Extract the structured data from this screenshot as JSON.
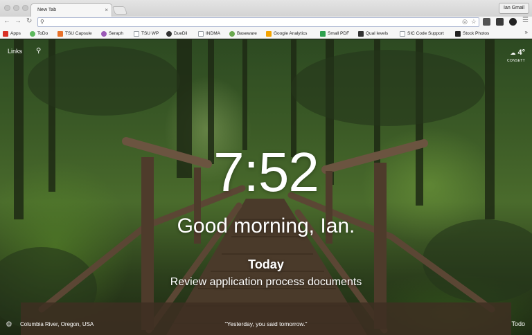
{
  "browser": {
    "tab_title": "New Tab",
    "tab_close": "×",
    "profile_name": "Ian Gmail",
    "omnibox_value": ""
  },
  "bookmarks": [
    {
      "label": "Apps",
      "color": "#d93025"
    },
    {
      "label": "ToDo",
      "color": "#5cb85c"
    },
    {
      "label": "TSU Capsule",
      "color": "#e8712a"
    },
    {
      "label": "Seraph",
      "color": "#9b59b6"
    },
    {
      "label": "TSU WP",
      "color": "#9aa0a6"
    },
    {
      "label": "DueDil",
      "color": "#333333"
    },
    {
      "label": "INDMA",
      "color": "#9aa0a6"
    },
    {
      "label": "Baseware",
      "color": "#6aa84f"
    },
    {
      "label": "Google Analytics",
      "color": "#f4a300"
    },
    {
      "label": "Small PDF",
      "color": "#2ea04f"
    },
    {
      "label": "Qual levels",
      "color": "#333333"
    },
    {
      "label": "SIC Code Support",
      "color": "#9aa0a6"
    },
    {
      "label": "Stock Photos",
      "color": "#222222"
    }
  ],
  "momentum": {
    "links_label": "Links",
    "time": "7:52",
    "greeting": "Good morning, Ian.",
    "focus_heading": "Today",
    "focus_text": "Review application process documents",
    "weather_temp": "4°",
    "weather_location": "CONSETT",
    "photo_location": "Columbia River, Oregon, USA",
    "quote": "\"Yesterday, you said tomorrow.\"",
    "todo_label": "Todo"
  }
}
